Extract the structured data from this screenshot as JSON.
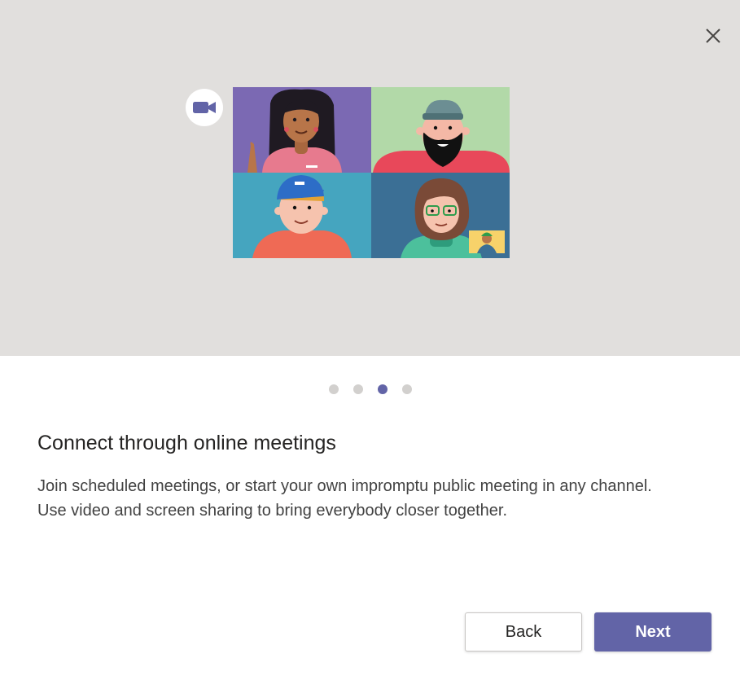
{
  "dialog": {
    "title": "Connect through online meetings",
    "description_line1": "Join scheduled meetings, or start your own impromptu public meeting in any channel.",
    "description_line2": "Use video and screen sharing to bring everybody closer together."
  },
  "pagination": {
    "total": 4,
    "active": 3
  },
  "buttons": {
    "back_label": "Back",
    "next_label": "Next"
  },
  "icons": {
    "close": "close-icon",
    "video": "video-camera-icon"
  },
  "colors": {
    "accent": "#6264a7",
    "hero_background": "#e1dfdd",
    "dot_inactive": "#d2d0ce",
    "tile_purple": "#7b69b3",
    "tile_green": "#b2d9a8",
    "tile_teal": "#45a5bf",
    "tile_blue": "#3b6f95"
  }
}
